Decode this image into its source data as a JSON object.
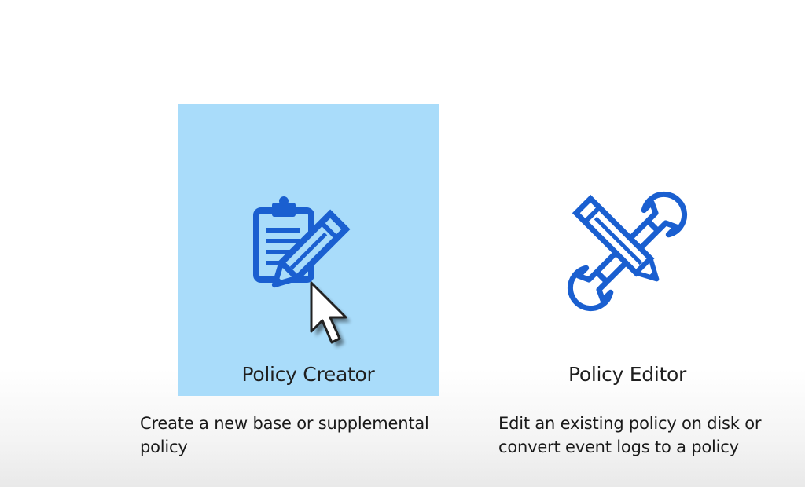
{
  "options": [
    {
      "label": "Policy Creator",
      "description": "Create a new base or supplemental policy",
      "icon": "clipboard-pencil-icon",
      "selected": true
    },
    {
      "label": "Policy Editor",
      "description": "Edit an existing policy on disk or convert event logs to a policy",
      "icon": "pencil-wrench-icon",
      "selected": false
    }
  ],
  "colors": {
    "icon_blue": "#1a5fd0",
    "selected_background": "#a9dcfa"
  },
  "cursor_icon": "mouse-pointer-icon"
}
